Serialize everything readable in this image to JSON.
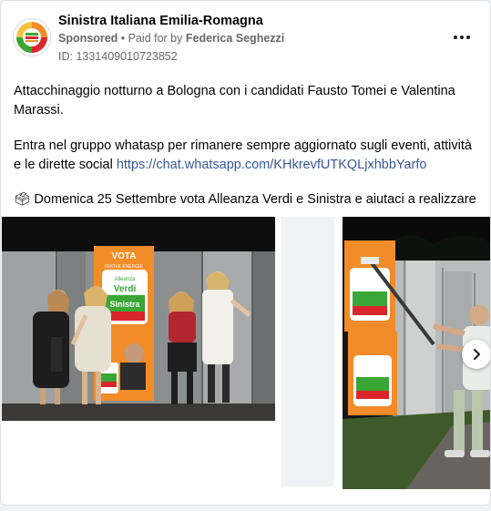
{
  "post": {
    "page_name": "Sinistra Italiana Emilia-Romagna",
    "sponsored": "Sponsored",
    "paid_prefix": "• Paid for by",
    "payer": "Federica Seghezzi",
    "id_line": "ID: 1331409010723852",
    "paragraph1": "Attacchinaggio notturno a Bologna con i candidati Fausto Tomei e Valentina Marassi.",
    "paragraph2_text": "Entra nel gruppo whatasp per rimanere sempre aggiornato sugli eventi, attività e le dirette social ",
    "paragraph2_link": "https://chat.whatsapp.com/KHkrevfUTKQLjxhbbYarfo",
    "paragraph3": "🗳 Domenica 25 Settembre vota Alleanza Verdi e Sinistra e aiutaci a realizzare un…"
  },
  "poster": {
    "vota": "VOTA",
    "nuove": "NUOVE ENERGIE",
    "brand_top": "Alleanza",
    "brand_mid": "Verdi",
    "brand_bot": "Sinistra"
  },
  "icons": {
    "more": "more-options-icon",
    "next": "chevron-right-icon",
    "ballot": "ballot-box-icon"
  },
  "colors": {
    "link": "#385898",
    "secondary_text": "#65676b",
    "poster_orange": "#f28c28",
    "poster_green": "#3aa635",
    "poster_red": "#d9262b"
  }
}
